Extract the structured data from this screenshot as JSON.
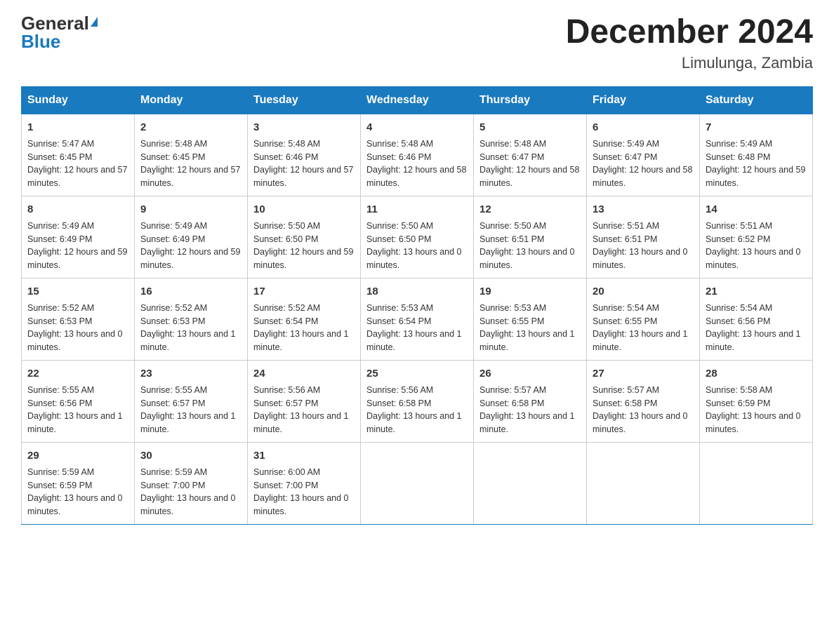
{
  "header": {
    "logo_general": "General",
    "logo_blue": "Blue",
    "month_title": "December 2024",
    "location": "Limulunga, Zambia"
  },
  "weekdays": [
    "Sunday",
    "Monday",
    "Tuesday",
    "Wednesday",
    "Thursday",
    "Friday",
    "Saturday"
  ],
  "weeks": [
    [
      {
        "day": "1",
        "sunrise": "5:47 AM",
        "sunset": "6:45 PM",
        "daylight": "12 hours and 57 minutes."
      },
      {
        "day": "2",
        "sunrise": "5:48 AM",
        "sunset": "6:45 PM",
        "daylight": "12 hours and 57 minutes."
      },
      {
        "day": "3",
        "sunrise": "5:48 AM",
        "sunset": "6:46 PM",
        "daylight": "12 hours and 57 minutes."
      },
      {
        "day": "4",
        "sunrise": "5:48 AM",
        "sunset": "6:46 PM",
        "daylight": "12 hours and 58 minutes."
      },
      {
        "day": "5",
        "sunrise": "5:48 AM",
        "sunset": "6:47 PM",
        "daylight": "12 hours and 58 minutes."
      },
      {
        "day": "6",
        "sunrise": "5:49 AM",
        "sunset": "6:47 PM",
        "daylight": "12 hours and 58 minutes."
      },
      {
        "day": "7",
        "sunrise": "5:49 AM",
        "sunset": "6:48 PM",
        "daylight": "12 hours and 59 minutes."
      }
    ],
    [
      {
        "day": "8",
        "sunrise": "5:49 AM",
        "sunset": "6:49 PM",
        "daylight": "12 hours and 59 minutes."
      },
      {
        "day": "9",
        "sunrise": "5:49 AM",
        "sunset": "6:49 PM",
        "daylight": "12 hours and 59 minutes."
      },
      {
        "day": "10",
        "sunrise": "5:50 AM",
        "sunset": "6:50 PM",
        "daylight": "12 hours and 59 minutes."
      },
      {
        "day": "11",
        "sunrise": "5:50 AM",
        "sunset": "6:50 PM",
        "daylight": "13 hours and 0 minutes."
      },
      {
        "day": "12",
        "sunrise": "5:50 AM",
        "sunset": "6:51 PM",
        "daylight": "13 hours and 0 minutes."
      },
      {
        "day": "13",
        "sunrise": "5:51 AM",
        "sunset": "6:51 PM",
        "daylight": "13 hours and 0 minutes."
      },
      {
        "day": "14",
        "sunrise": "5:51 AM",
        "sunset": "6:52 PM",
        "daylight": "13 hours and 0 minutes."
      }
    ],
    [
      {
        "day": "15",
        "sunrise": "5:52 AM",
        "sunset": "6:53 PM",
        "daylight": "13 hours and 0 minutes."
      },
      {
        "day": "16",
        "sunrise": "5:52 AM",
        "sunset": "6:53 PM",
        "daylight": "13 hours and 1 minute."
      },
      {
        "day": "17",
        "sunrise": "5:52 AM",
        "sunset": "6:54 PM",
        "daylight": "13 hours and 1 minute."
      },
      {
        "day": "18",
        "sunrise": "5:53 AM",
        "sunset": "6:54 PM",
        "daylight": "13 hours and 1 minute."
      },
      {
        "day": "19",
        "sunrise": "5:53 AM",
        "sunset": "6:55 PM",
        "daylight": "13 hours and 1 minute."
      },
      {
        "day": "20",
        "sunrise": "5:54 AM",
        "sunset": "6:55 PM",
        "daylight": "13 hours and 1 minute."
      },
      {
        "day": "21",
        "sunrise": "5:54 AM",
        "sunset": "6:56 PM",
        "daylight": "13 hours and 1 minute."
      }
    ],
    [
      {
        "day": "22",
        "sunrise": "5:55 AM",
        "sunset": "6:56 PM",
        "daylight": "13 hours and 1 minute."
      },
      {
        "day": "23",
        "sunrise": "5:55 AM",
        "sunset": "6:57 PM",
        "daylight": "13 hours and 1 minute."
      },
      {
        "day": "24",
        "sunrise": "5:56 AM",
        "sunset": "6:57 PM",
        "daylight": "13 hours and 1 minute."
      },
      {
        "day": "25",
        "sunrise": "5:56 AM",
        "sunset": "6:58 PM",
        "daylight": "13 hours and 1 minute."
      },
      {
        "day": "26",
        "sunrise": "5:57 AM",
        "sunset": "6:58 PM",
        "daylight": "13 hours and 1 minute."
      },
      {
        "day": "27",
        "sunrise": "5:57 AM",
        "sunset": "6:58 PM",
        "daylight": "13 hours and 0 minutes."
      },
      {
        "day": "28",
        "sunrise": "5:58 AM",
        "sunset": "6:59 PM",
        "daylight": "13 hours and 0 minutes."
      }
    ],
    [
      {
        "day": "29",
        "sunrise": "5:59 AM",
        "sunset": "6:59 PM",
        "daylight": "13 hours and 0 minutes."
      },
      {
        "day": "30",
        "sunrise": "5:59 AM",
        "sunset": "7:00 PM",
        "daylight": "13 hours and 0 minutes."
      },
      {
        "day": "31",
        "sunrise": "6:00 AM",
        "sunset": "7:00 PM",
        "daylight": "13 hours and 0 minutes."
      },
      null,
      null,
      null,
      null
    ]
  ]
}
